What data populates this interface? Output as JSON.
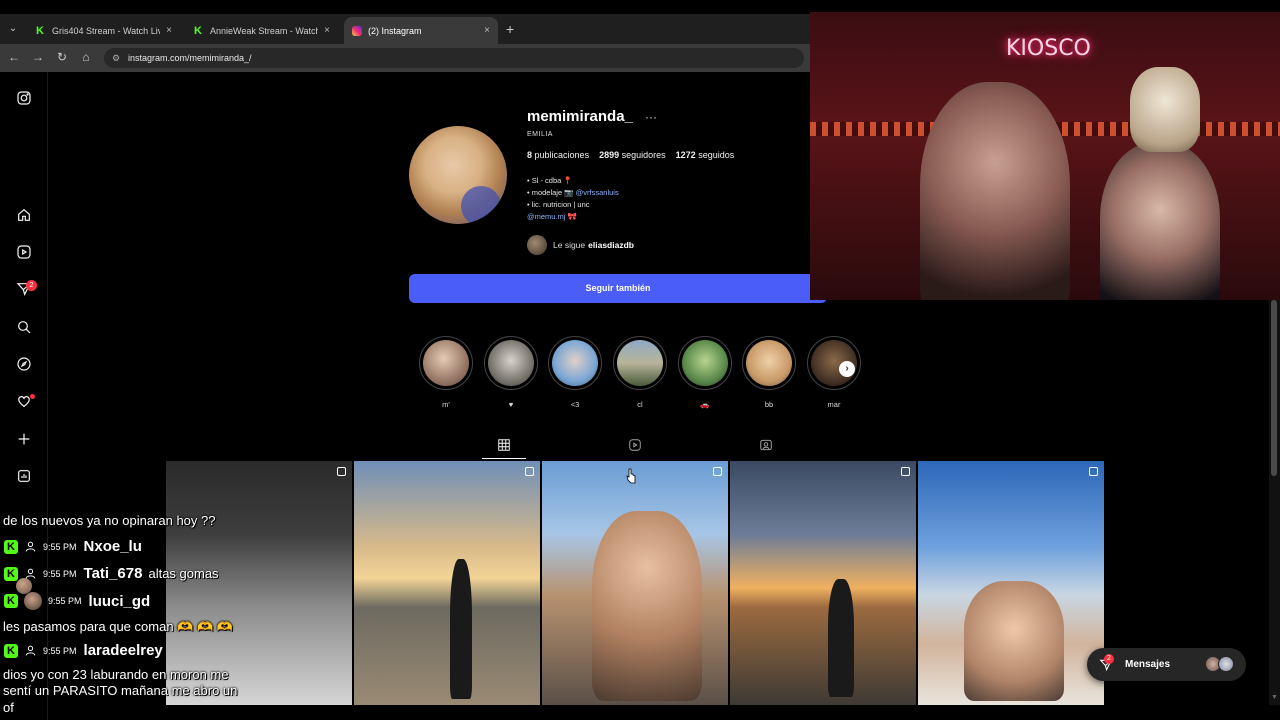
{
  "browser": {
    "tabs": [
      {
        "title": "Gris404 Stream - Watch Live on",
        "favicon": "kick-icon",
        "active": false
      },
      {
        "title": "AnnieWeak Stream - Watch Live",
        "favicon": "kick-icon",
        "active": false
      },
      {
        "title": "(2) Instagram",
        "favicon": "instagram-icon",
        "active": true
      }
    ],
    "url": "instagram.com/memimiranda_/",
    "new_tab": "+",
    "close": "×"
  },
  "sidebar": {
    "notifications_badge": "2"
  },
  "profile": {
    "username": "memimiranda_",
    "more": "···",
    "full_name": "EMILIA",
    "posts_count": "8",
    "posts_label": "publicaciones",
    "followers_count": "2899",
    "followers_label": "seguidores",
    "following_count": "1272",
    "following_label": "seguidos",
    "bio_line1": "• Sl - cdba 📍",
    "bio_line2_prefix": "• modelaje 📷",
    "bio_line2_link": "@vrfssanluis",
    "bio_line3": "• lic. nutricion | unc",
    "bio_line4_link": "@memu.mj",
    "bio_line4_suffix": "🎀",
    "followed_by_prefix": "Le sigue",
    "followed_by_user": "eliasdiazdb",
    "follow_button": "Seguir también"
  },
  "highlights": [
    {
      "label": "m'"
    },
    {
      "label": "♥"
    },
    {
      "label": "<3"
    },
    {
      "label": "cl"
    },
    {
      "label": "🚗"
    },
    {
      "label": "bb"
    },
    {
      "label": "mar"
    }
  ],
  "highlight_next": "›",
  "webcam": {
    "sign_text": "KIOSCO"
  },
  "chat": {
    "line_top": "de los nuevos ya no opinaran hoy ??",
    "rows": [
      {
        "time": "9:55 PM",
        "user": "Nxoe_lu",
        "msg": ""
      },
      {
        "time": "9:55 PM",
        "user": "Tati_678",
        "msg": "altas gomas"
      },
      {
        "time": "9:55 PM",
        "user": "luuci_gd",
        "msg": ""
      }
    ],
    "line_mid": "les pasamos para que coman 🫶 🫶 🫶",
    "row4": {
      "time": "9:55 PM",
      "user": "laradeelrey",
      "msg": ""
    },
    "line_bottom1": "dios yo con 23 laburando en moron me",
    "line_bottom2": "sentí un PARASITO mañana me abro un",
    "line_bottom3": "of"
  },
  "messages": {
    "label": "Mensajes",
    "badge": "2"
  },
  "colors": {
    "follow_button": "#4a5df9",
    "link": "#8ab4ff",
    "badge": "#ff3040",
    "kick_green": "#53fc18"
  }
}
